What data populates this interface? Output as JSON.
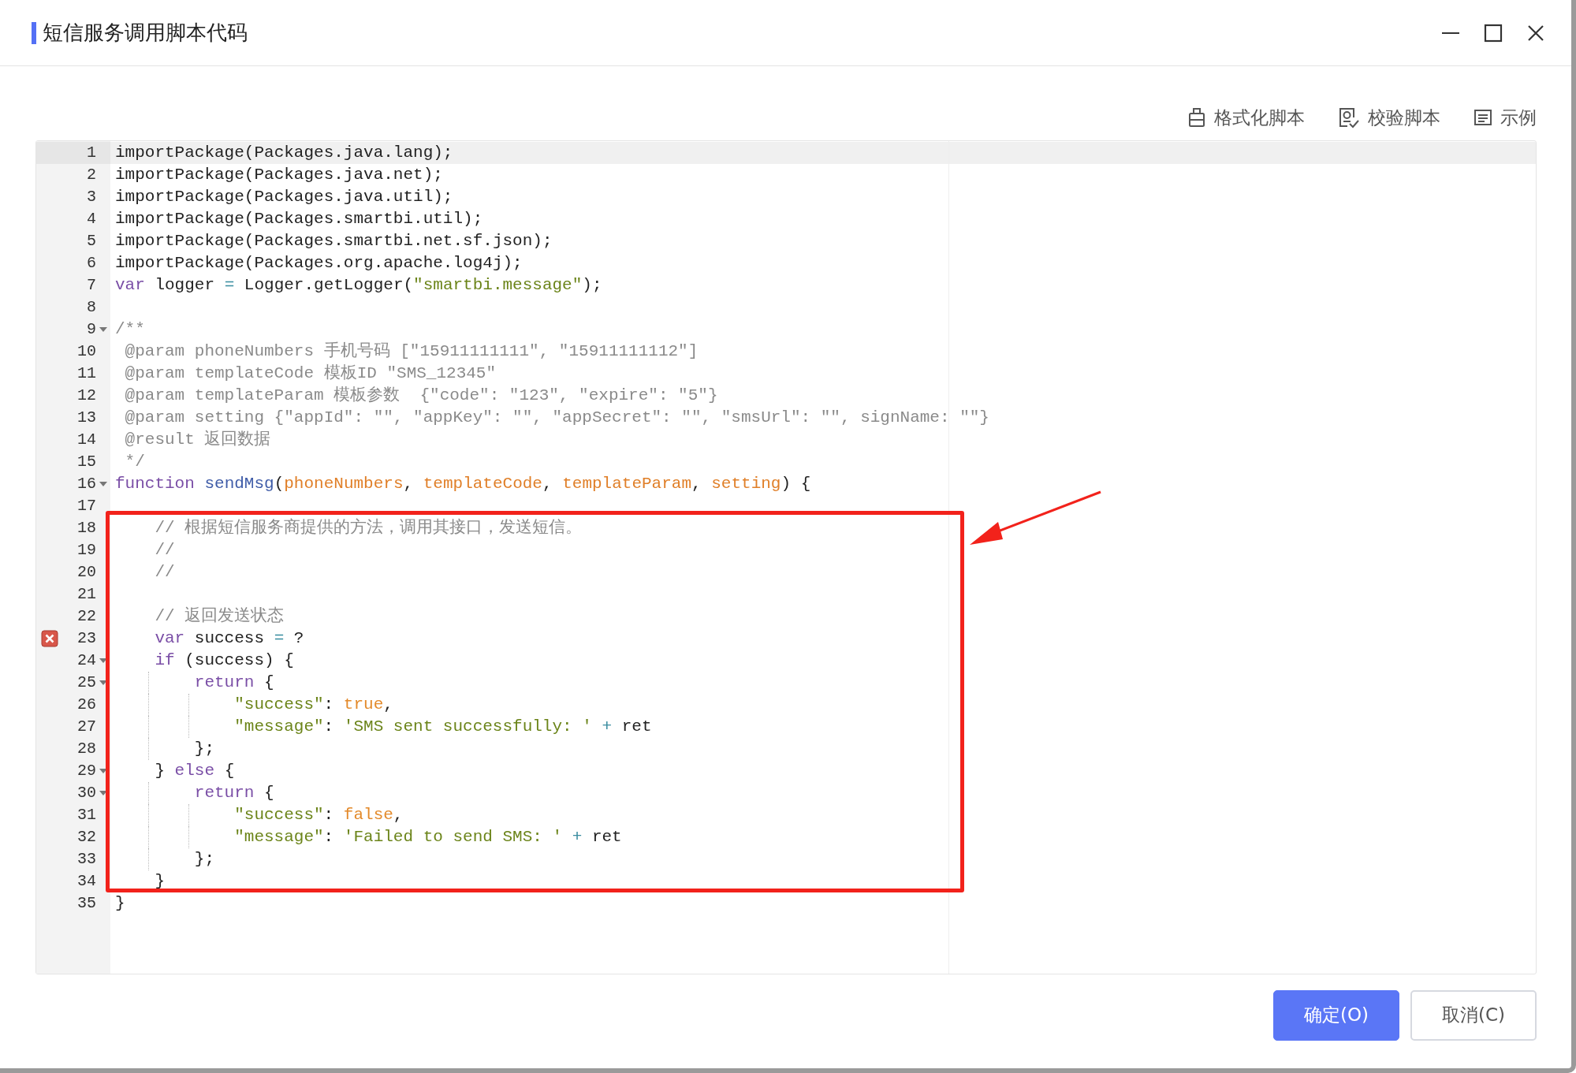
{
  "window": {
    "title": "短信服务调用脚本代码"
  },
  "toolbar": [
    {
      "label": "格式化脚本",
      "kind": "format"
    },
    {
      "label": "校验脚本",
      "kind": "verify"
    },
    {
      "label": "示例",
      "kind": "example"
    }
  ],
  "editor": {
    "lines": [
      {
        "number": "1",
        "current": true,
        "fold": false,
        "error": false,
        "tokens": [
          {
            "kind": "plain",
            "text": "importPackage(Packages.java.lang);"
          }
        ]
      },
      {
        "number": "2",
        "current": false,
        "fold": false,
        "error": false,
        "tokens": [
          {
            "kind": "plain",
            "text": "importPackage(Packages.java.net);"
          }
        ]
      },
      {
        "number": "3",
        "current": false,
        "fold": false,
        "error": false,
        "tokens": [
          {
            "kind": "plain",
            "text": "importPackage(Packages.java.util);"
          }
        ]
      },
      {
        "number": "4",
        "current": false,
        "fold": false,
        "error": false,
        "tokens": [
          {
            "kind": "plain",
            "text": "importPackage(Packages.smartbi.util);"
          }
        ]
      },
      {
        "number": "5",
        "current": false,
        "fold": false,
        "error": false,
        "tokens": [
          {
            "kind": "plain",
            "text": "importPackage(Packages.smartbi.net.sf.json);"
          }
        ]
      },
      {
        "number": "6",
        "current": false,
        "fold": false,
        "error": false,
        "tokens": [
          {
            "kind": "plain",
            "text": "importPackage(Packages.org.apache.log4j);"
          }
        ]
      },
      {
        "number": "7",
        "current": false,
        "fold": false,
        "error": false,
        "tokens": [
          {
            "kind": "keyword",
            "text": "var"
          },
          {
            "kind": "plain",
            "text": " logger "
          },
          {
            "kind": "operator",
            "text": "="
          },
          {
            "kind": "plain",
            "text": " Logger.getLogger("
          },
          {
            "kind": "string",
            "text": "\"smartbi.message\""
          },
          {
            "kind": "plain",
            "text": ");"
          }
        ]
      },
      {
        "number": "8",
        "current": false,
        "fold": false,
        "error": false
      },
      {
        "number": "9",
        "current": false,
        "fold": true,
        "error": false,
        "tokens": [
          {
            "kind": "comment",
            "text": "/**"
          }
        ]
      },
      {
        "number": "10",
        "current": false,
        "fold": false,
        "error": false,
        "tokens": [
          {
            "kind": "comment",
            "text": " @param phoneNumbers 手机号码 [\"15911111111\", \"15911111112\"]"
          }
        ]
      },
      {
        "number": "11",
        "current": false,
        "fold": false,
        "error": false,
        "tokens": [
          {
            "kind": "comment",
            "text": " @param templateCode 模板ID \"SMS_12345\""
          }
        ]
      },
      {
        "number": "12",
        "current": false,
        "fold": false,
        "error": false,
        "tokens": [
          {
            "kind": "comment",
            "text": " @param templateParam 模板参数  {\"code\": \"123\", \"expire\": \"5\"}"
          }
        ]
      },
      {
        "number": "13",
        "current": false,
        "fold": false,
        "error": false,
        "tokens": [
          {
            "kind": "comment",
            "text": " @param setting {\"appId\": \"\", \"appKey\": \"\", \"appSecret\": \"\", \"smsUrl\": \"\", signName: \"\"}"
          }
        ]
      },
      {
        "number": "14",
        "current": false,
        "fold": false,
        "error": false,
        "tokens": [
          {
            "kind": "comment",
            "text": " @result 返回数据"
          }
        ]
      },
      {
        "number": "15",
        "current": false,
        "fold": false,
        "error": false,
        "tokens": [
          {
            "kind": "comment",
            "text": " */"
          }
        ]
      },
      {
        "number": "16",
        "current": false,
        "fold": true,
        "error": false,
        "tokens": [
          {
            "kind": "keyword",
            "text": "function"
          },
          {
            "kind": "def",
            "text": " sendMsg"
          },
          {
            "kind": "plain",
            "text": "("
          },
          {
            "kind": "param",
            "text": "phoneNumbers"
          },
          {
            "kind": "plain",
            "text": ", "
          },
          {
            "kind": "param",
            "text": "templateCode"
          },
          {
            "kind": "plain",
            "text": ", "
          },
          {
            "kind": "param",
            "text": "templateParam"
          },
          {
            "kind": "plain",
            "text": ", "
          },
          {
            "kind": "param",
            "text": "setting"
          },
          {
            "kind": "plain",
            "text": ") {"
          }
        ]
      },
      {
        "number": "17",
        "current": false,
        "fold": false,
        "error": false
      },
      {
        "number": "18",
        "current": false,
        "fold": false,
        "error": false,
        "tokens": [
          {
            "kind": "comment",
            "text": "    // 根据短信服务商提供的方法，调用其接口，发送短信。"
          }
        ]
      },
      {
        "number": "19",
        "current": false,
        "fold": false,
        "error": false,
        "tokens": [
          {
            "kind": "comment",
            "text": "    //"
          }
        ]
      },
      {
        "number": "20",
        "current": false,
        "fold": false,
        "error": false,
        "tokens": [
          {
            "kind": "comment",
            "text": "    //"
          }
        ]
      },
      {
        "number": "21",
        "current": false,
        "fold": false,
        "error": false
      },
      {
        "number": "22",
        "current": false,
        "fold": false,
        "error": false,
        "tokens": [
          {
            "kind": "comment",
            "text": "    // 返回发送状态"
          }
        ]
      },
      {
        "number": "23",
        "current": false,
        "fold": false,
        "error": true,
        "tokens": [
          {
            "kind": "keyword",
            "text": "    var"
          },
          {
            "kind": "plain",
            "text": " success "
          },
          {
            "kind": "operator",
            "text": "="
          },
          {
            "kind": "plain",
            "text": " ?"
          }
        ]
      },
      {
        "number": "24",
        "current": false,
        "fold": true,
        "error": false,
        "tokens": [
          {
            "kind": "keyword",
            "text": "    if"
          },
          {
            "kind": "plain",
            "text": " (success) {"
          }
        ]
      },
      {
        "number": "25",
        "current": false,
        "fold": true,
        "error": false,
        "tokens": [
          {
            "kind": "keyword",
            "text": "        return"
          },
          {
            "kind": "plain",
            "text": " {"
          }
        ]
      },
      {
        "number": "26",
        "current": false,
        "fold": false,
        "error": false,
        "tokens": [
          {
            "kind": "string",
            "text": "            \"success\""
          },
          {
            "kind": "plain",
            "text": ": "
          },
          {
            "kind": "literal",
            "text": "true"
          },
          {
            "kind": "plain",
            "text": ","
          }
        ]
      },
      {
        "number": "27",
        "current": false,
        "fold": false,
        "error": false,
        "tokens": [
          {
            "kind": "string",
            "text": "            \"message\""
          },
          {
            "kind": "plain",
            "text": ": "
          },
          {
            "kind": "string",
            "text": "'SMS sent successfully: '"
          },
          {
            "kind": "operator",
            "text": " +"
          },
          {
            "kind": "plain",
            "text": " ret"
          }
        ]
      },
      {
        "number": "28",
        "current": false,
        "fold": false,
        "error": false,
        "tokens": [
          {
            "kind": "plain",
            "text": "        };"
          }
        ]
      },
      {
        "number": "29",
        "current": false,
        "fold": true,
        "error": false,
        "tokens": [
          {
            "kind": "plain",
            "text": "    } "
          },
          {
            "kind": "keyword",
            "text": "else"
          },
          {
            "kind": "plain",
            "text": " {"
          }
        ]
      },
      {
        "number": "30",
        "current": false,
        "fold": true,
        "error": false,
        "tokens": [
          {
            "kind": "keyword",
            "text": "        return"
          },
          {
            "kind": "plain",
            "text": " {"
          }
        ]
      },
      {
        "number": "31",
        "current": false,
        "fold": false,
        "error": false,
        "tokens": [
          {
            "kind": "string",
            "text": "            \"success\""
          },
          {
            "kind": "plain",
            "text": ": "
          },
          {
            "kind": "literal",
            "text": "false"
          },
          {
            "kind": "plain",
            "text": ","
          }
        ]
      },
      {
        "number": "32",
        "current": false,
        "fold": false,
        "error": false,
        "tokens": [
          {
            "kind": "string",
            "text": "            \"message\""
          },
          {
            "kind": "plain",
            "text": ": "
          },
          {
            "kind": "string",
            "text": "'Failed to send SMS: '"
          },
          {
            "kind": "operator",
            "text": " +"
          },
          {
            "kind": "plain",
            "text": " ret"
          }
        ]
      },
      {
        "number": "33",
        "current": false,
        "fold": false,
        "error": false,
        "tokens": [
          {
            "kind": "plain",
            "text": "        };"
          }
        ]
      },
      {
        "number": "34",
        "current": false,
        "fold": false,
        "error": false,
        "tokens": [
          {
            "kind": "plain",
            "text": "    }"
          }
        ]
      },
      {
        "number": "35",
        "current": false,
        "fold": false,
        "error": false,
        "tokens": [
          {
            "kind": "plain",
            "text": "}"
          }
        ]
      }
    ]
  },
  "buttons": [
    {
      "label": "确定(O)",
      "kind": "primary"
    },
    {
      "label": "取消(C)",
      "kind": "secondary"
    }
  ]
}
